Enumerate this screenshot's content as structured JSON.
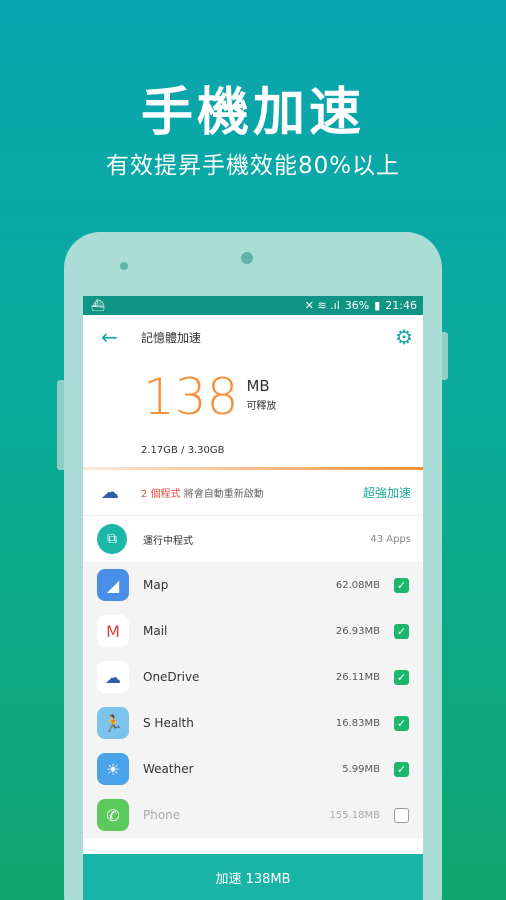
{
  "promo": {
    "headline": "手機加速",
    "subline": "有效提昇手機效能80%以上"
  },
  "status": {
    "icons": "✕ ≋ .ıl",
    "battery": "36%",
    "time": "21:46"
  },
  "appbar": {
    "title": "記憶體加速"
  },
  "memory": {
    "amount": "138",
    "unit": "MB",
    "label": "可釋放",
    "ratio": "2.17GB / 3.30GB"
  },
  "notice": {
    "count": "2 個程式",
    "text": " 將會自動重新啟動",
    "action": "超強加速"
  },
  "running": {
    "label": "運行中程式",
    "count": "43 Apps"
  },
  "apps": [
    {
      "name": "Map",
      "size": "62.08MB",
      "checked": true,
      "icon": "map-icon",
      "color": "#4a8fe7"
    },
    {
      "name": "Mail",
      "size": "26.93MB",
      "checked": true,
      "icon": "mail-icon",
      "color": "#ffffff"
    },
    {
      "name": "OneDrive",
      "size": "26.11MB",
      "checked": true,
      "icon": "onedrive-icon",
      "color": "#ffffff"
    },
    {
      "name": "S Health",
      "size": "16.83MB",
      "checked": true,
      "icon": "s-health-icon",
      "color": "#7cc4ee"
    },
    {
      "name": "Weather",
      "size": "5.99MB",
      "checked": true,
      "icon": "weather-icon",
      "color": "#4aa3e8"
    },
    {
      "name": "Phone",
      "size": "155.18MB",
      "checked": false,
      "icon": "phone-icon",
      "color": "#5cc95c"
    }
  ],
  "footer": {
    "button": "加速 138MB"
  }
}
